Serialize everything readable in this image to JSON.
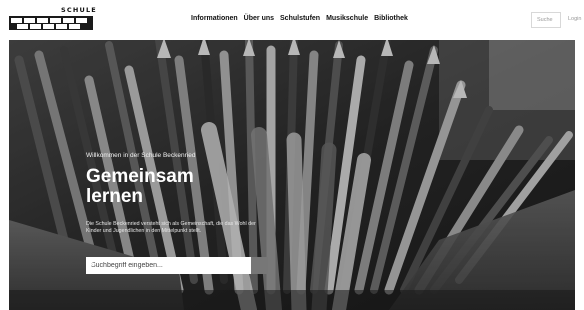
{
  "header": {
    "logo": {
      "word": "SCHULE",
      "subword": "BECKENRIED"
    },
    "nav": [
      {
        "label": "Informationen"
      },
      {
        "label": "Über uns"
      },
      {
        "label": "Schulstufen"
      },
      {
        "label": "Musikschule"
      },
      {
        "label": "Bibliothek"
      }
    ],
    "search_label": "Suche",
    "login_label": "Login"
  },
  "hero": {
    "kicker": "Willkommen in der Schule Beckenried",
    "title_line1": "Gemeinsam",
    "title_line2": "lernen",
    "description": "Die Schule Beckenried versteht sich als Gemeinschaft, die das Wohl der Kinder und Jugendlichen in den Mittelpunkt stellt.",
    "search": {
      "placeholder": "Suchbegriff eingeben..."
    }
  }
}
